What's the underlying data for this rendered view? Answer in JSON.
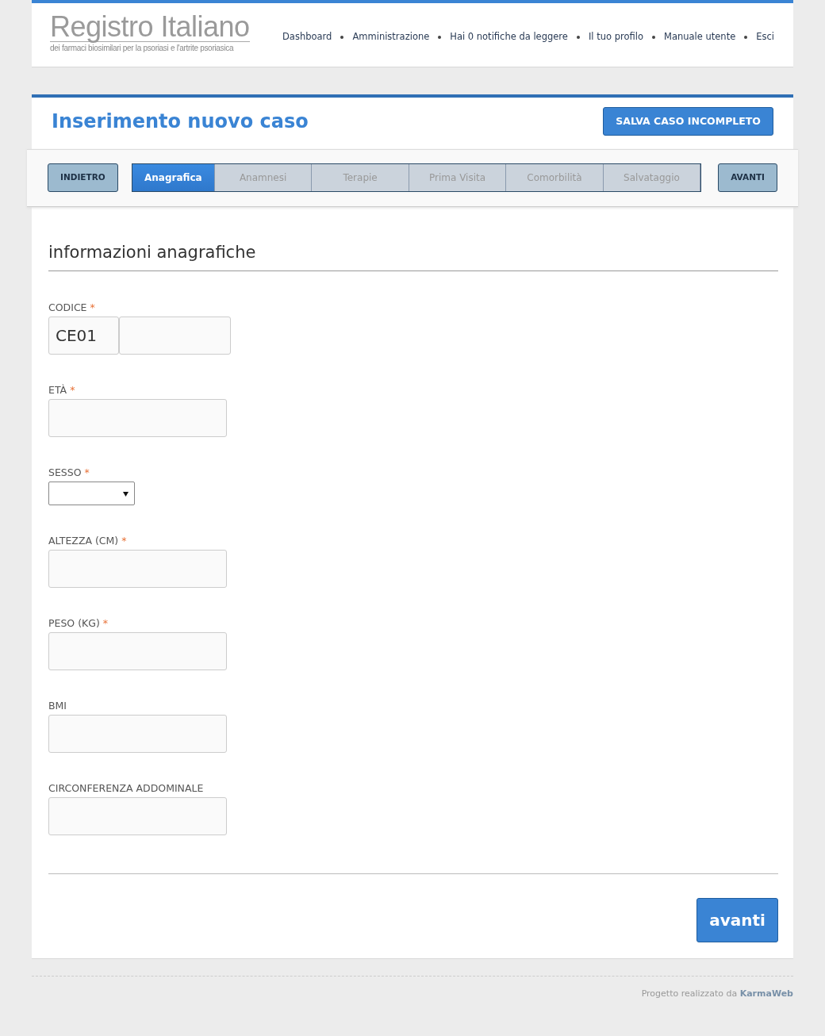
{
  "header": {
    "logo_title": "Registro Italiano",
    "logo_subtitle": "dei farmaci biosimilari per la psoriasi e l'artrite psoriasica",
    "nav": [
      "Dashboard",
      "Amministrazione",
      "Hai 0 notifiche da leggere",
      "Il tuo profilo",
      "Manuale utente",
      "Esci"
    ]
  },
  "page": {
    "title": "Inserimento nuovo caso",
    "save_button": "SALVA CASO INCOMPLETO"
  },
  "wizard": {
    "back": "INDIETRO",
    "next": "AVANTI",
    "steps": [
      {
        "label": "Anagrafica",
        "selected": true
      },
      {
        "label": "Anamnesi",
        "selected": false
      },
      {
        "label": "Terapie",
        "selected": false
      },
      {
        "label": "Prima Visita",
        "selected": false
      },
      {
        "label": "Comorbilità",
        "selected": false
      },
      {
        "label": "Salvataggio",
        "selected": false
      }
    ]
  },
  "form": {
    "section_title": "informazioni anagrafiche",
    "fields": [
      {
        "kind": "split",
        "label": "CODICE",
        "required_mark": "*",
        "value": "CE01"
      },
      {
        "kind": "input",
        "label": "ETÀ",
        "required_mark": "*"
      },
      {
        "kind": "select",
        "label": "SESSO",
        "required_mark": "*"
      },
      {
        "kind": "input",
        "label": "ALTEZZA (CM)",
        "required_mark": "*"
      },
      {
        "kind": "input",
        "label": "PESO (KG)",
        "required_mark": "*"
      },
      {
        "kind": "input",
        "label": "BMI"
      },
      {
        "kind": "input",
        "label": "CIRCONFERENZA ADDOMINALE"
      }
    ],
    "submit": "avanti"
  },
  "footer": {
    "text": "Progetto realizzato da **KarmaWeb**"
  }
}
